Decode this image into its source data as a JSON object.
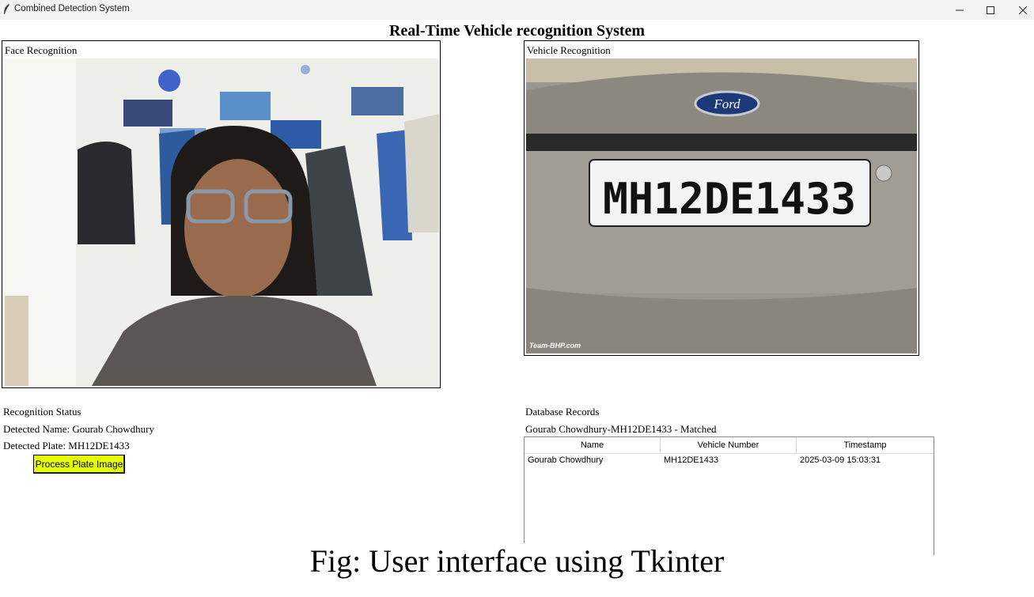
{
  "window": {
    "title": "Combined Detection System",
    "icon": "feather-icon",
    "controls": [
      "minimize-icon",
      "maximize-icon",
      "close-icon"
    ]
  },
  "heading": "Real-Time Vehicle recognition System",
  "face_panel": {
    "label": "Face Recognition"
  },
  "vehicle_panel": {
    "label": "Vehicle Recognition",
    "car_badge": "Ford",
    "plate_text": "MH12DE1433",
    "watermark": "Team-BHP.com"
  },
  "status": {
    "heading": "Recognition Status",
    "detected_name": "Detected Name: Gourab Chowdhury",
    "detected_plate": "Detected Plate: MH12DE1433",
    "process_button": "Process Plate Image",
    "button_color": "#e6ff00"
  },
  "database": {
    "heading": "Database Records",
    "match_text": "Gourab Chowdhury-MH12DE1433 - Matched",
    "columns": [
      "Name",
      "Vehicle Number",
      "Timestamp"
    ],
    "rows": [
      [
        "Gourab Chowdhury",
        "MH12DE1433",
        "2025-03-09 15:03:31"
      ]
    ]
  },
  "caption": "Fig: User interface using Tkinter"
}
